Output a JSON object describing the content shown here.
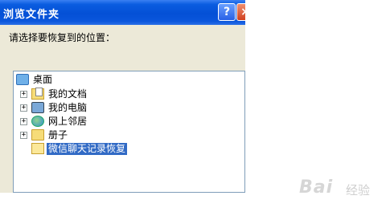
{
  "window": {
    "title": "浏览文件夹",
    "help_label": "?",
    "close_label": "×"
  },
  "prompt": "请选择要恢复到的位置：",
  "tree": {
    "root": {
      "label": "桌面",
      "icon": "desktop-icon"
    },
    "items": [
      {
        "label": "我的文档",
        "icon": "documents-folder-icon",
        "expander": "+"
      },
      {
        "label": "我的电脑",
        "icon": "computer-icon",
        "expander": "+"
      },
      {
        "label": "网上邻居",
        "icon": "network-icon",
        "expander": "+"
      },
      {
        "label": "册子",
        "icon": "folder-icon",
        "expander": "+"
      },
      {
        "label": "微信聊天记录恢复",
        "icon": "open-folder-icon",
        "expander": "",
        "selected": true
      }
    ]
  },
  "watermark": {
    "brand": "Bai",
    "sub": "经验"
  },
  "colors": {
    "titlebar": "#0450d6",
    "selection": "#316ac5",
    "dialog_bg": "#ece9d8"
  }
}
